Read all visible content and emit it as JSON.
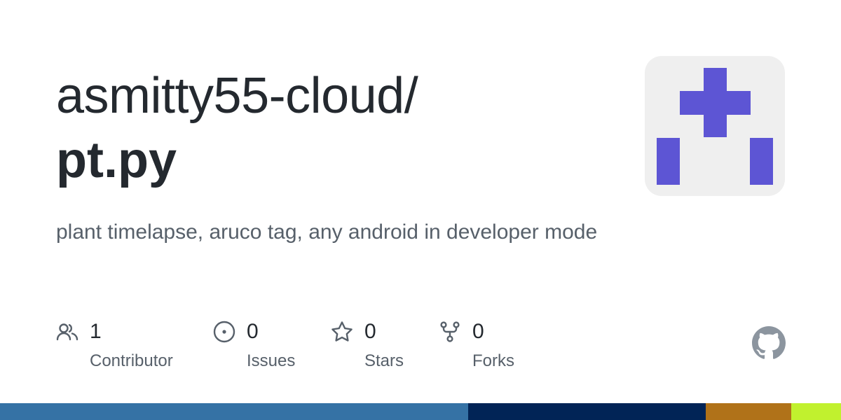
{
  "repo": {
    "owner": "asmitty55-cloud/",
    "name": "pt.py",
    "description": "plant timelapse, aruco tag, any android in developer mode"
  },
  "avatar": {
    "icon": "identicon-avatar",
    "color": "#5d55d4",
    "background": "#efefef"
  },
  "stats": [
    {
      "icon": "people-icon",
      "value": "1",
      "label": "Contributor"
    },
    {
      "icon": "issue-opened-icon",
      "value": "0",
      "label": "Issues"
    },
    {
      "icon": "star-icon",
      "value": "0",
      "label": "Stars"
    },
    {
      "icon": "repo-forked-icon",
      "value": "0",
      "label": "Forks"
    }
  ],
  "logo": {
    "icon": "github-mark-icon",
    "color": "#8c959f"
  },
  "language_bar": [
    {
      "color": "#3572a5",
      "fraction": 0.557
    },
    {
      "color": "#012456",
      "fraction": 0.282
    },
    {
      "color": "#b07219",
      "fraction": 0.102
    },
    {
      "color": "#c1f12e",
      "fraction": 0.059
    }
  ]
}
